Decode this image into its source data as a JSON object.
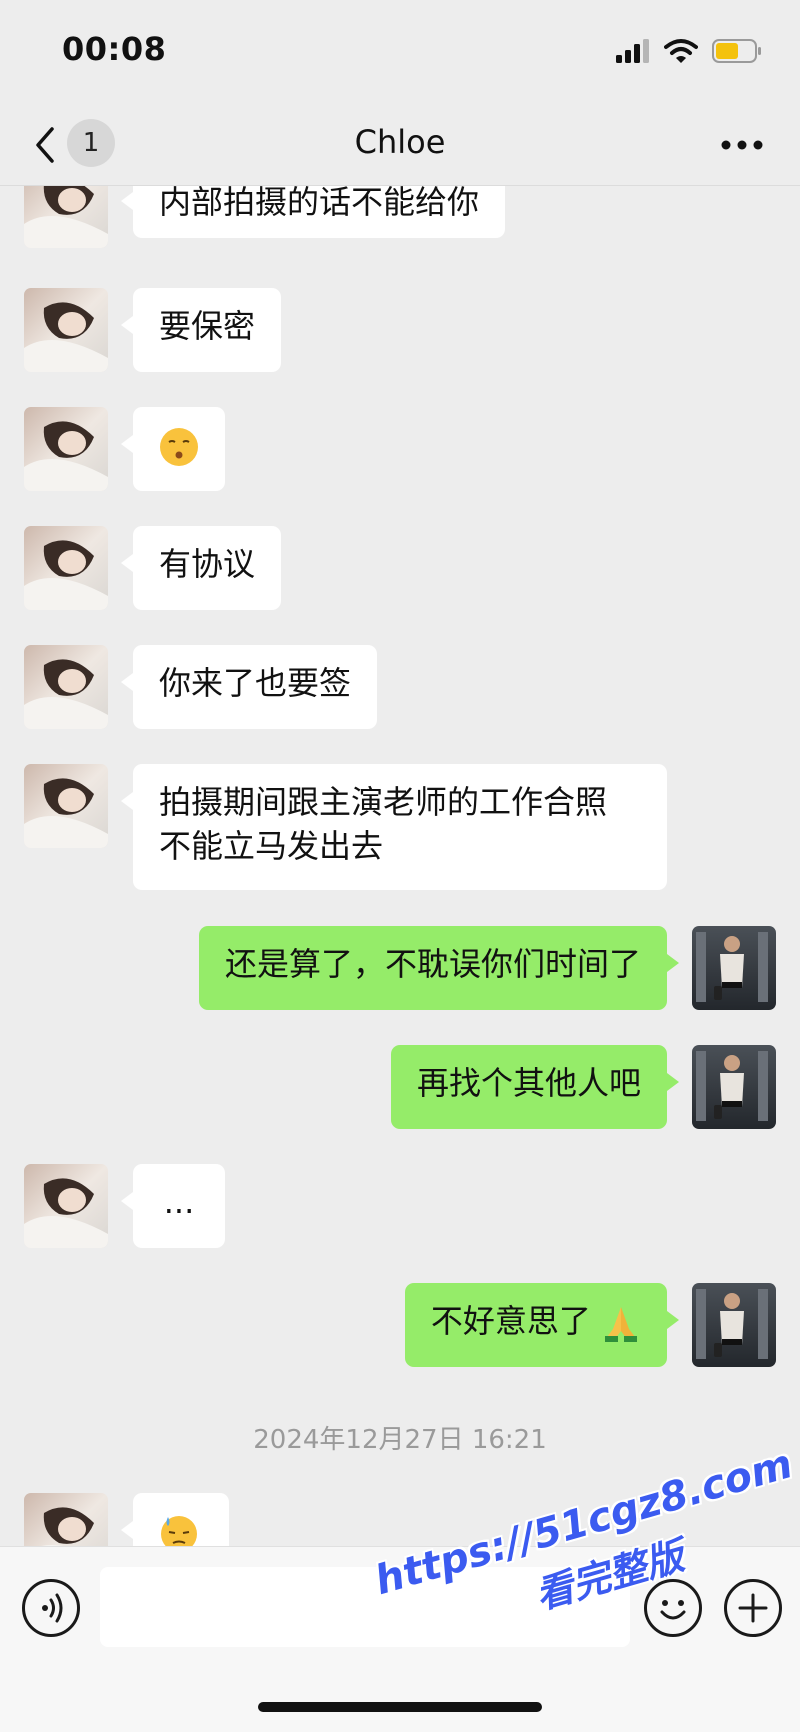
{
  "status_bar": {
    "time": "00:08"
  },
  "header": {
    "unread_count": "1",
    "title": "Chloe"
  },
  "messages": [
    {
      "side": "in",
      "text": "内部拍摄的话不能给你"
    },
    {
      "side": "in",
      "text": "要保密"
    },
    {
      "side": "in",
      "text": "",
      "emoji": "shushing-face-emoji"
    },
    {
      "side": "in",
      "text": "有协议"
    },
    {
      "side": "in",
      "text": "你来了也要签"
    },
    {
      "side": "in",
      "line1": "拍摄期间跟主演老师的工作合照",
      "line2": "不能立马发出去"
    },
    {
      "side": "out",
      "text": "还是算了，不耽误你们时间了"
    },
    {
      "side": "out",
      "text": "再找个其他人吧"
    },
    {
      "side": "in",
      "text": "..."
    },
    {
      "side": "out",
      "text": "不好意思了",
      "emoji": "folded-hands-emoji"
    },
    {
      "side": "in",
      "text": "",
      "emoji": "downcast-sweat-face-emoji"
    }
  ],
  "timestamp": "2024年12月27日 16:21",
  "watermark": {
    "line1": "https://51cgz8.com",
    "line2": "看完整版"
  },
  "colors": {
    "background": "#ededed",
    "incoming_bubble": "#ffffff",
    "outgoing_bubble": "#95ec69",
    "watermark": "#3b5bf0"
  }
}
